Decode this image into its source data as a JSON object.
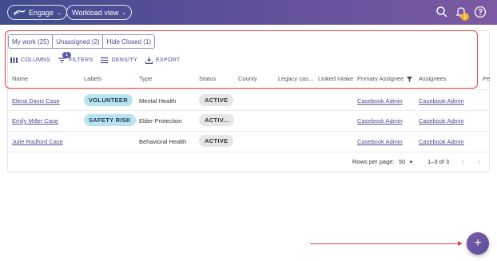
{
  "topbar": {
    "app_label": "Engage",
    "view_label": "Workload view",
    "notification_count": "1",
    "colors": {
      "gradient_start": "#3f4d8f",
      "gradient_end": "#7c59a3"
    }
  },
  "tabs": [
    {
      "label": "My work (25)"
    },
    {
      "label": "Unassigned (2)"
    },
    {
      "label": "Hide Closed (1)"
    }
  ],
  "toolbar": {
    "columns": "COLUMNS",
    "filters": "FILTERS",
    "filters_badge": "1",
    "density": "DENSITY",
    "export": "EXPORT"
  },
  "table": {
    "headers": [
      "Name",
      "Labels",
      "Type",
      "Status",
      "County",
      "Legacy cas...",
      "Linked intake",
      "Primary Assignee",
      "Assignees",
      "Pe"
    ],
    "rows": [
      {
        "name": "Elena Davis Case",
        "label": "VOLUNTEER",
        "type": "Mental Health",
        "status": "ACTIVE",
        "primary": "Casebook Admin",
        "assignees": "Casebook Admin"
      },
      {
        "name": "Emily Miller Case",
        "label": "SAFETY RISK",
        "type": "Elder Protection",
        "status": "ACTIV...",
        "primary": "Casebook Admin",
        "assignees": "Casebook Admin"
      },
      {
        "name": "Julie Radford Case",
        "label": "",
        "type": "Behavioral Health",
        "status": "ACTIVE",
        "primary": "Casebook Admin",
        "assignees": "Casebook Admin"
      }
    ]
  },
  "pagination": {
    "rows_per_page_label": "Rows per page:",
    "rows_per_page_value": "50",
    "range": "1–3 of 3"
  },
  "fab": {
    "label": "+"
  }
}
